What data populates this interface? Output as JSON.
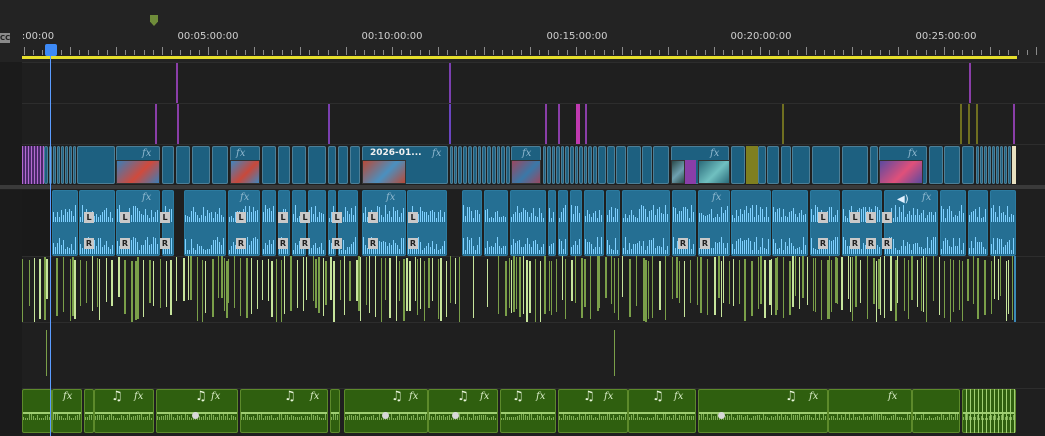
{
  "timeline": {
    "ruler": {
      "cc_label": "CC",
      "time_labels": [
        {
          "text": ":00:00",
          "seconds": 0
        },
        {
          "text": "00:05:00:00",
          "seconds": 300
        },
        {
          "text": "00:10:00:00",
          "seconds": 600
        },
        {
          "text": "00:15:00:00",
          "seconds": 900
        },
        {
          "text": "00:20:00:00",
          "seconds": 1200
        },
        {
          "text": "00:25:00:00",
          "seconds": 1500
        }
      ]
    },
    "clip_title": "2026-01...",
    "fx_label": "fx",
    "channel_left": "L",
    "channel_right": "R",
    "music_note": "♫",
    "colors": {
      "background": "#1f1f1f",
      "video_clip": "#1d6080",
      "audio_clip": "#256f93",
      "audio_wave": "#7fd0ff",
      "music_clip": "#2f5f0f",
      "music_wave": "#7fae55",
      "playhead": "#3d8af7",
      "work_area": "#e6df2c"
    },
    "icons": {
      "marker": "marker-icon",
      "playhead": "playhead-icon",
      "audio_speaker": "speaker-icon",
      "music_note": "music-note-icon",
      "waveform": "waveform-icon"
    }
  }
}
